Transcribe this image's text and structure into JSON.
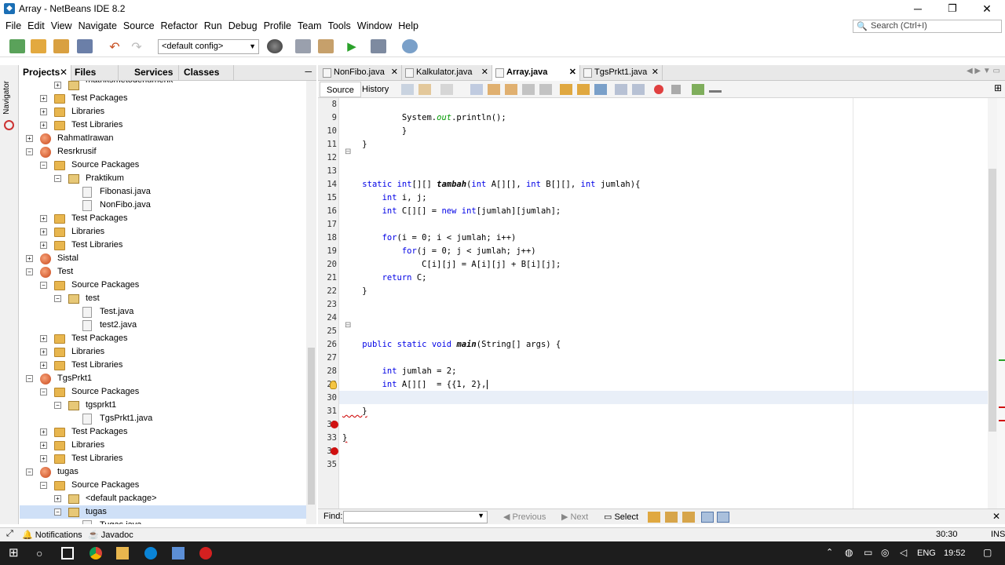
{
  "window": {
    "title": "Array - NetBeans IDE 8.2",
    "minimize": "─",
    "maximize": "❐",
    "close": "✕"
  },
  "menu": [
    "File",
    "Edit",
    "View",
    "Navigate",
    "Source",
    "Refactor",
    "Run",
    "Debug",
    "Profile",
    "Team",
    "Tools",
    "Window",
    "Help"
  ],
  "search": {
    "placeholder": "Search (Ctrl+I)",
    "icon": "search-icon"
  },
  "toolbar": {
    "config": "<default config>"
  },
  "navigator_label": "Navigator",
  "project_tabs": [
    {
      "label": "Projects",
      "close": "✕"
    },
    {
      "label": "Files"
    },
    {
      "label": "Services"
    },
    {
      "label": "Classes"
    }
  ],
  "panel_minimize": "─",
  "tree": [
    {
      "label": "matriksmetodenumerik",
      "type": "pkg",
      "level": 3,
      "partial": true
    },
    {
      "label": "Test Packages",
      "type": "fold",
      "level": 2
    },
    {
      "label": "Libraries",
      "type": "fold",
      "level": 2
    },
    {
      "label": "Test Libraries",
      "type": "fold",
      "level": 2
    },
    {
      "label": "RahmatIrawan",
      "type": "proj",
      "level": 1
    },
    {
      "label": "Resrkrusif",
      "type": "proj",
      "level": 1,
      "open": true
    },
    {
      "label": "Source Packages",
      "type": "fold",
      "level": 2,
      "open": true
    },
    {
      "label": "Praktikum",
      "type": "pkg",
      "level": 3,
      "open": true
    },
    {
      "label": "Fibonasi.java",
      "type": "java",
      "level": 4
    },
    {
      "label": "NonFibo.java",
      "type": "java",
      "level": 4
    },
    {
      "label": "Test Packages",
      "type": "fold",
      "level": 2
    },
    {
      "label": "Libraries",
      "type": "fold",
      "level": 2
    },
    {
      "label": "Test Libraries",
      "type": "fold",
      "level": 2
    },
    {
      "label": "Sistal",
      "type": "proj",
      "level": 1
    },
    {
      "label": "Test",
      "type": "proj",
      "level": 1,
      "open": true
    },
    {
      "label": "Source Packages",
      "type": "fold",
      "level": 2,
      "open": true
    },
    {
      "label": "test",
      "type": "pkg",
      "level": 3,
      "open": true
    },
    {
      "label": "Test.java",
      "type": "java",
      "level": 4
    },
    {
      "label": "test2.java",
      "type": "java",
      "level": 4
    },
    {
      "label": "Test Packages",
      "type": "fold",
      "level": 2
    },
    {
      "label": "Libraries",
      "type": "fold",
      "level": 2
    },
    {
      "label": "Test Libraries",
      "type": "fold",
      "level": 2
    },
    {
      "label": "TgsPrkt1",
      "type": "proj",
      "level": 1,
      "open": true
    },
    {
      "label": "Source Packages",
      "type": "fold",
      "level": 2,
      "open": true
    },
    {
      "label": "tgsprkt1",
      "type": "pkg",
      "level": 3,
      "open": true
    },
    {
      "label": "TgsPrkt1.java",
      "type": "java",
      "level": 4
    },
    {
      "label": "Test Packages",
      "type": "fold",
      "level": 2
    },
    {
      "label": "Libraries",
      "type": "fold",
      "level": 2
    },
    {
      "label": "Test Libraries",
      "type": "fold",
      "level": 2
    },
    {
      "label": "tugas",
      "type": "proj",
      "level": 1,
      "open": true
    },
    {
      "label": "Source Packages",
      "type": "fold",
      "level": 2,
      "open": true
    },
    {
      "label": "<default package>",
      "type": "pkg",
      "level": 3
    },
    {
      "label": "tugas",
      "type": "pkg",
      "level": 3,
      "open": true,
      "selected": true
    },
    {
      "label": "Tugas.java",
      "type": "java",
      "level": 4
    }
  ],
  "editor_tabs": [
    {
      "label": "NonFibo.java",
      "close": "✕"
    },
    {
      "label": "Kalkulator.java",
      "close": "✕"
    },
    {
      "label": "Array.java",
      "close": "✕",
      "active": true
    },
    {
      "label": "TgsPrkt1.java",
      "close": "✕"
    }
  ],
  "editor_modes": [
    {
      "label": "Source",
      "active": true
    },
    {
      "label": "History"
    }
  ],
  "line_numbers": [
    "8",
    "9",
    "10",
    "11",
    "12",
    "13",
    "14",
    "15",
    "16",
    "17",
    "18",
    "19",
    "20",
    "21",
    "22",
    "23",
    "24",
    "25",
    "26",
    "27",
    "28",
    "29",
    "30",
    "31",
    "32",
    "33",
    "34",
    "35"
  ],
  "code": [
    "",
    "            System.out.println();",
    "            }",
    "    }",
    "",
    "",
    "    static int[][] tambah(int A[][], int B[][], int jumlah){",
    "        int i, j;",
    "        int C[][] = new int[jumlah][jumlah];",
    "",
    "        for(i = 0; i < jumlah; i++)",
    "            for(j = 0; j < jumlah; j++)",
    "                C[i][j] = A[i][j] + B[i][j];",
    "        return C;",
    "    }",
    "",
    "",
    "",
    "    public static void main(String[] args) {",
    "",
    "        int jumlah = 2;",
    "        int A[][]  = {{1, 2},",
    "",
    "    }",
    "",
    "}",
    ""
  ],
  "find": {
    "label": "Find:",
    "previous": "Previous",
    "next": "Next",
    "select": "Select"
  },
  "status": {
    "notifications": "Notifications",
    "javadoc": "Javadoc",
    "position": "30:30",
    "mode": "INS"
  },
  "taskbar": {
    "lang": "ENG",
    "time": "19:52"
  },
  "colors": {
    "keyword": "#0000e6",
    "field": "#009900",
    "error": "#d01010",
    "selection": "#cfe0f7"
  }
}
